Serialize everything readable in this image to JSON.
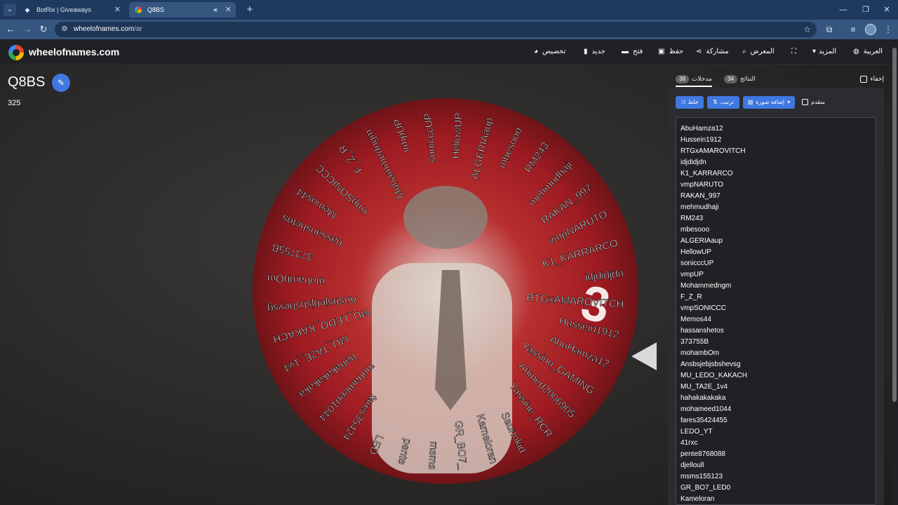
{
  "browser": {
    "tabs": [
      {
        "title": "BotRix | Giveaways",
        "active": false
      },
      {
        "title": "Q8BS",
        "active": true
      }
    ],
    "url_host": "wheelofnames.com",
    "url_path": "/ar"
  },
  "header": {
    "logo": "wheelofnames.com",
    "menu": {
      "language": "العربية",
      "more": "المزيد",
      "gallery": "المعرض",
      "share": "مشاركة",
      "save": "حفظ",
      "open": "فتح",
      "new": "جديد",
      "customize": "تخصيص"
    }
  },
  "wheel": {
    "title": "Q8BS",
    "count": "325"
  },
  "panel": {
    "hide_label": "إخفاء",
    "tabs": {
      "entries_label": "مدخلات",
      "entries_count": "38",
      "results_label": "النتائج",
      "results_count": "34"
    },
    "buttons": {
      "shuffle": "خلط",
      "sort": "ترتيب",
      "add_image": "إضافة صورة"
    },
    "advanced_label": "متقدم",
    "entries": [
      "AbuHamza12",
      "Hussein1912",
      "RTGxAMAROVITCH",
      "idjdidjdn",
      "K1_KARRARCO",
      "vmpNARUTO",
      "RAKAN_997",
      "mehmudhaji",
      "RM243",
      "mbesooo",
      "ALGERIAaup",
      "HellowUP",
      "sonicccUP",
      "vmpUP",
      "Mohammedngm",
      "F_Z_R",
      "vmpSONICCC",
      "Memos44",
      "hassanshetos",
      "373755B",
      "mohambOm",
      "Ansbsjebjsbshevsg",
      "MU_LEDO_KAKACH",
      "MU_TA2E_1v4",
      "hahakakakaka",
      "mohameed1044",
      "fares35424455",
      "LEDO_YT",
      "41rxc",
      "pente8768088",
      "djelloull",
      "msms155123",
      "GR_BO7_LED0",
      "Kameloran"
    ]
  },
  "wheel_labels": [
    "AbuHamza12",
    "Yassino_GAMING",
    "Ahmed2006905",
    "Yassine_RCR",
    "Saunokid",
    "Kameloran",
    "GR_BO7_",
    "msms",
    "pente",
    "LED",
    "fares35424",
    "mohameed1044",
    "hahakakakaka",
    "MU_TA2E_1v4",
    "MU_LEDO_KAKACH",
    "Ansbsjebjsbshevsg",
    "mohambOm",
    "373755B",
    "hassanshetos",
    "Memos44",
    "vmpSONICCC",
    "F_Z_R",
    "Mohammedngm",
    "vmpUP",
    "sonicccUP",
    "HellowUP",
    "ALGERIAaup",
    "mbesooo",
    "RM243",
    "mehmudhaji",
    "RAKAN_997",
    "vmpNARUTO",
    "K1_KARRARCO",
    "idjdidjdn",
    "RTGxAMAROVITCH",
    "Hussein1912"
  ],
  "colors": {
    "accent": "#3f78e0",
    "wheel_red": "#c0202a"
  }
}
